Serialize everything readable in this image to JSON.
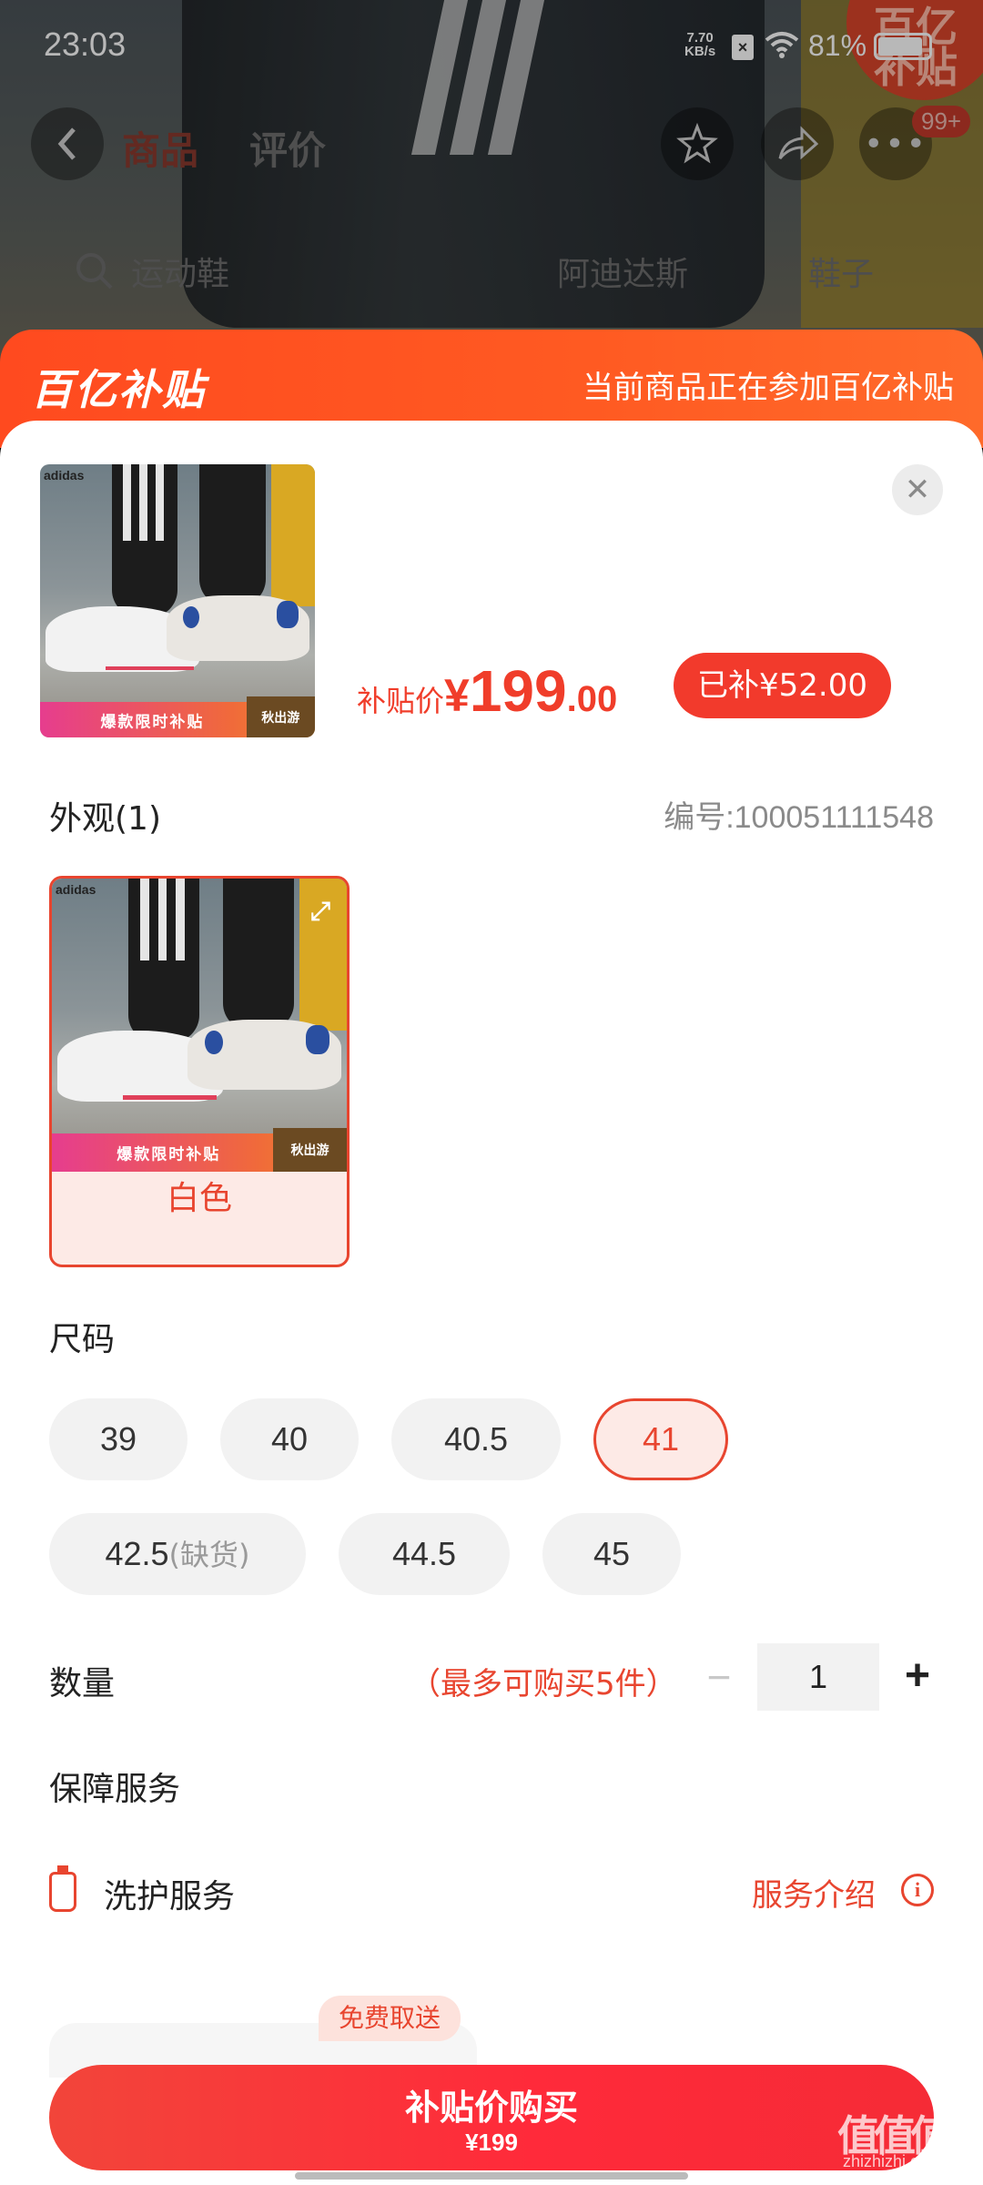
{
  "status_bar": {
    "time": "23:03",
    "net_speed_value": "7.70",
    "net_speed_unit": "KB/s",
    "battery": "81%"
  },
  "background_page": {
    "tabs": [
      "商品",
      "评价"
    ],
    "search_hint": "运动鞋",
    "chips": [
      "阿迪达斯",
      "鞋子"
    ],
    "badge": "99+",
    "corner_badge": "百亿\n补贴"
  },
  "banner": {
    "logo": "百亿补贴",
    "notice": "当前商品正在参加百亿补贴"
  },
  "product": {
    "image_strip_text": "爆款限时补贴",
    "image_corner_text": "秋出游",
    "brand": "adidas",
    "price_label": "补贴价",
    "currency": "¥",
    "price_int": "199",
    "price_dec": ".00",
    "subsidy": "已补¥52.00"
  },
  "appearance": {
    "title": "外观(1)",
    "sku_code": "编号:100051111548",
    "options": [
      {
        "label": "白色",
        "selected": true
      }
    ]
  },
  "size": {
    "title": "尺码",
    "options": [
      {
        "label": "39"
      },
      {
        "label": "40"
      },
      {
        "label": "40.5"
      },
      {
        "label": "41",
        "selected": true
      },
      {
        "label": "42.5",
        "note": "(缺货)"
      },
      {
        "label": "44.5"
      },
      {
        "label": "45"
      }
    ]
  },
  "quantity": {
    "title": "数量",
    "limit_text": "（最多可购买5件）",
    "value": "1",
    "minus": "−",
    "plus": "+"
  },
  "service": {
    "title": "保障服务",
    "item_name": "洗护服务",
    "intro_link": "服务介绍",
    "free_tag": "免费取送"
  },
  "buy_button": {
    "label": "补贴价购买",
    "price": "¥199"
  },
  "watermark": {
    "text": "值值值",
    "sub": "zhizhizhi.com"
  },
  "colors": {
    "accent": "#E8452F",
    "banner": "#FF4A1F",
    "buy": "#F52B36"
  }
}
